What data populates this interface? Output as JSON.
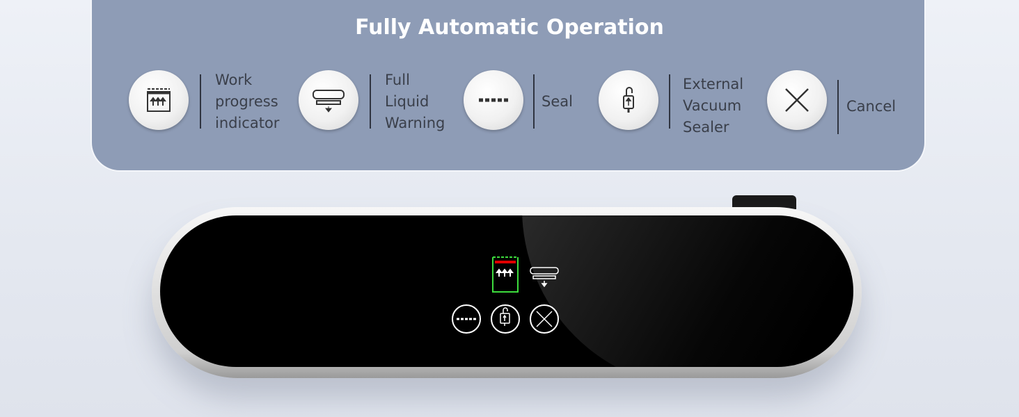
{
  "title": "Fully Automatic Operation",
  "features": [
    {
      "icon": "work-progress-icon",
      "lines": [
        "Work",
        "progress",
        "indicator"
      ]
    },
    {
      "icon": "liquid-warning-icon",
      "lines": [
        "Full",
        "Liquid",
        "Warning"
      ]
    },
    {
      "icon": "seal-icon",
      "lines": [
        "Seal"
      ]
    },
    {
      "icon": "external-vacuum-icon",
      "lines": [
        "External",
        "Vacuum",
        "Sealer"
      ]
    },
    {
      "icon": "cancel-icon",
      "lines": [
        "Cancel"
      ]
    }
  ],
  "colors": {
    "panel": "#8e9cb6",
    "progress_border": "#3ddc3d",
    "progress_bar": "#e00000"
  }
}
